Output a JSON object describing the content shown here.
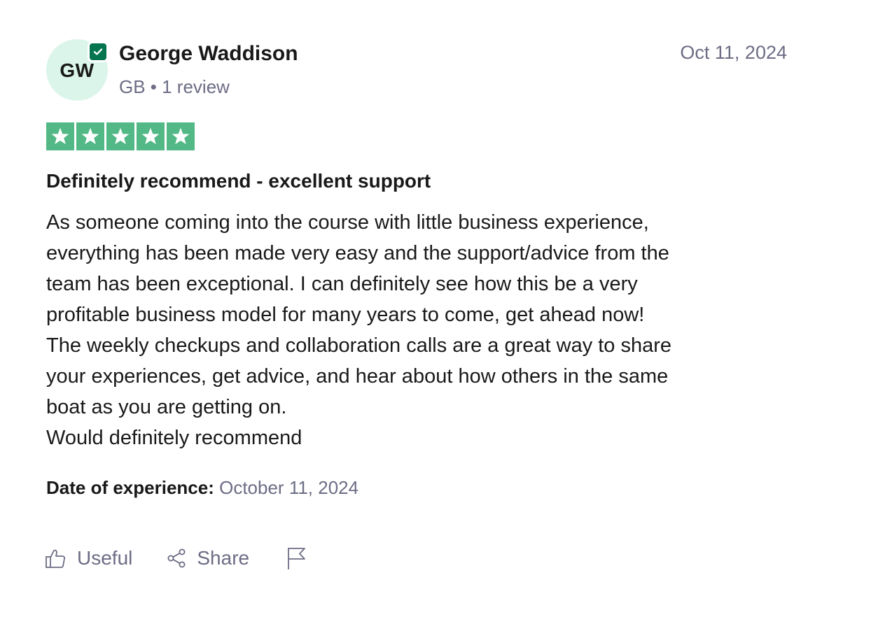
{
  "reviewer": {
    "initials": "GW",
    "name": "George Waddison",
    "meta": "GB • 1 review",
    "verified_icon": "verified-check-icon"
  },
  "review": {
    "date": "Oct 11, 2024",
    "rating": 5,
    "rating_max": 5,
    "title": "Definitely recommend - excellent support",
    "body_lines": [
      "As someone coming into the course with little business experience,",
      "everything has been made very easy and the support/advice from the",
      "team has been exceptional. I can definitely see how this be a very",
      "profitable business model for many years to come, get ahead now!",
      "The weekly checkups and collaboration calls are a great way to share",
      "your experiences, get advice, and hear about how others in the same",
      "boat as you are getting on.",
      "Would definitely recommend"
    ],
    "experience_label": "Date of experience:",
    "experience_date": "October 11, 2024"
  },
  "actions": {
    "useful_label": "Useful",
    "share_label": "Share",
    "useful_icon": "thumbs-up-icon",
    "share_icon": "share-icon",
    "flag_icon": "flag-icon"
  },
  "colors": {
    "star_green": "#52b986",
    "avatar_bg": "#dcf5ea",
    "verified_green": "#04754e",
    "muted_text": "#6c6c85",
    "main_text": "#191919"
  }
}
